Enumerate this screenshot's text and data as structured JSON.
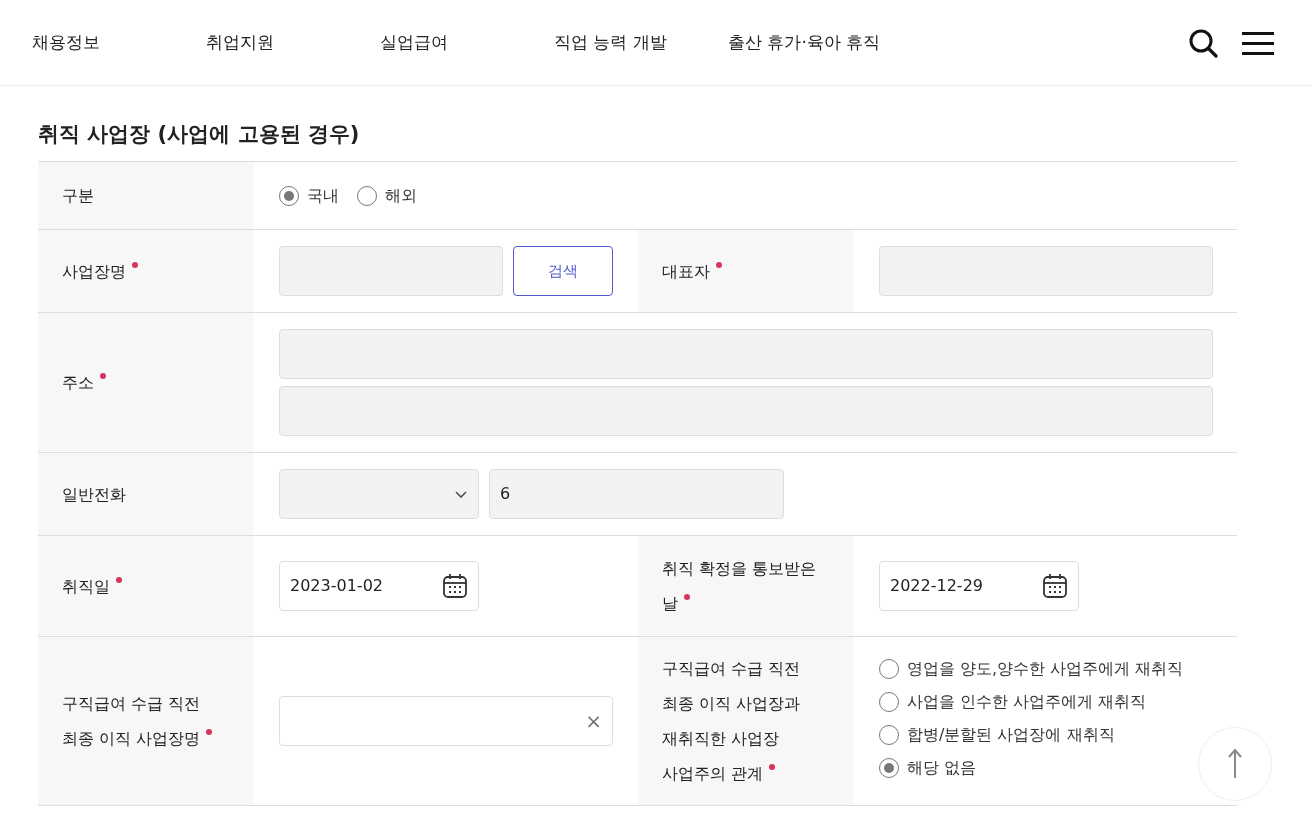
{
  "nav": {
    "items": [
      {
        "label": "채용정보"
      },
      {
        "label": "취업지원"
      },
      {
        "label": "실업급여"
      },
      {
        "label": "직업 능력 개발"
      },
      {
        "label": "출산 휴가·육아 휴직"
      }
    ]
  },
  "section_title": "취직 사업장 (사업에 고용된 경우)",
  "rows": [
    {
      "cells": [
        {
          "label_lines": [
            "구분"
          ],
          "required": false,
          "field": {
            "kind": "radio-inline",
            "options": [
              {
                "label": "국내",
                "selected": true
              },
              {
                "label": "해외",
                "selected": false
              }
            ]
          }
        }
      ]
    },
    {
      "cells": [
        {
          "label_lines": [
            "사업장명"
          ],
          "required": true,
          "field": {
            "kind": "search",
            "button": "검색",
            "disabled": true
          }
        },
        {
          "label_lines": [
            "대표자"
          ],
          "required": true,
          "field": {
            "kind": "text",
            "disabled": true
          }
        }
      ]
    },
    {
      "cells": [
        {
          "label_lines": [
            "주소"
          ],
          "required": true,
          "field": {
            "kind": "address",
            "disabled": true
          }
        }
      ]
    },
    {
      "cells": [
        {
          "label_lines": [
            "일반전화"
          ],
          "required": false,
          "field": {
            "kind": "phone",
            "value": "6",
            "disabled": true
          }
        }
      ]
    },
    {
      "cells": [
        {
          "label_lines": [
            "취직일"
          ],
          "required": true,
          "field": {
            "kind": "date",
            "value": "2023-01-02"
          }
        },
        {
          "label_lines": [
            "취직 확정을 통보받은",
            "날"
          ],
          "required": true,
          "field": {
            "kind": "date",
            "value": "2022-12-29"
          }
        }
      ]
    },
    {
      "cells": [
        {
          "label_lines": [
            "구직급여 수급 직전",
            "최종 이직 사업장명"
          ],
          "required": true,
          "field": {
            "kind": "clearable",
            "clear": "×"
          }
        },
        {
          "label_lines": [
            "구직급여 수급 직전",
            "최종 이직 사업장과",
            "재취직한 사업장",
            "사업주의 관계"
          ],
          "required": true,
          "field": {
            "kind": "radio-list",
            "options": [
              {
                "label": "영업을 양도,양수한 사업주에게 재취직",
                "selected": false
              },
              {
                "label": "사업을 인수한 사업주에게 재취직",
                "selected": false
              },
              {
                "label": "합병/분할된 사업장에 재취직",
                "selected": false
              },
              {
                "label": "해당 없음",
                "selected": true
              }
            ]
          }
        }
      ]
    }
  ]
}
